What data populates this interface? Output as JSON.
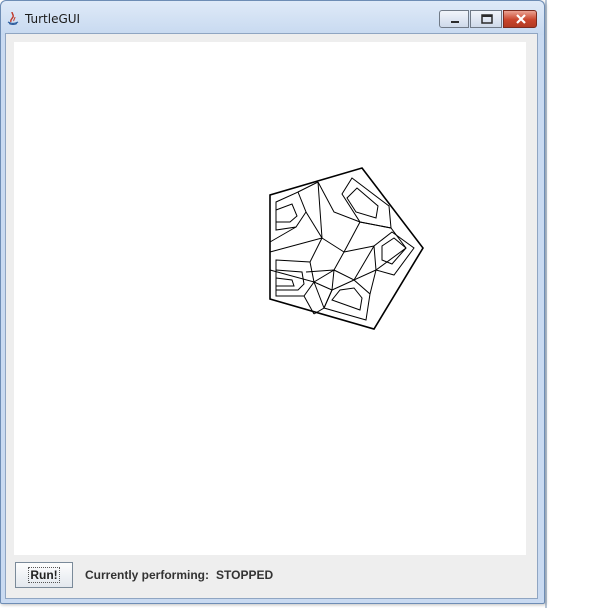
{
  "window": {
    "title": "TurtleGUI"
  },
  "toolbar": {
    "run_label": "Run!"
  },
  "status": {
    "label": "Currently performing:",
    "value": "STOPPED"
  }
}
